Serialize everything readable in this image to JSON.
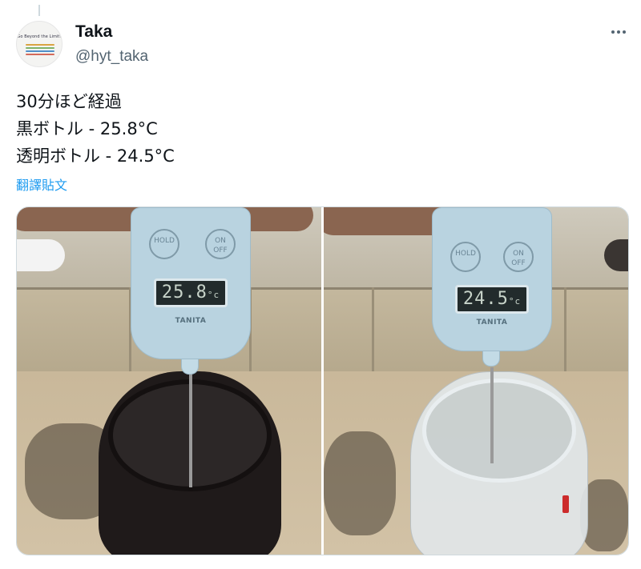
{
  "tweet": {
    "display_name": "Taka",
    "handle": "@hyt_taka",
    "avatar_text": "Go Beyond the Limit!",
    "lines": [
      "30分ほど経過",
      "黒ボトル - 25.8°C",
      "透明ボトル - 24.5°C"
    ],
    "translate_label": "翻譯貼文"
  },
  "media": {
    "photos": [
      {
        "reading": "25.8",
        "unit": "°c",
        "hold_label": "HOLD",
        "on_label": "ON",
        "off_label": "OFF",
        "brand": "TANITA"
      },
      {
        "reading": "24.5",
        "unit": "°c",
        "hold_label": "HOLD",
        "on_label": "ON",
        "off_label": "OFF",
        "brand": "TANITA"
      }
    ]
  },
  "colors": {
    "link": "#1d9bf0",
    "secondary_text": "#536471",
    "thermometer_body": "#b9d3e0"
  },
  "icons": {
    "more": "more-horizontal-icon"
  }
}
